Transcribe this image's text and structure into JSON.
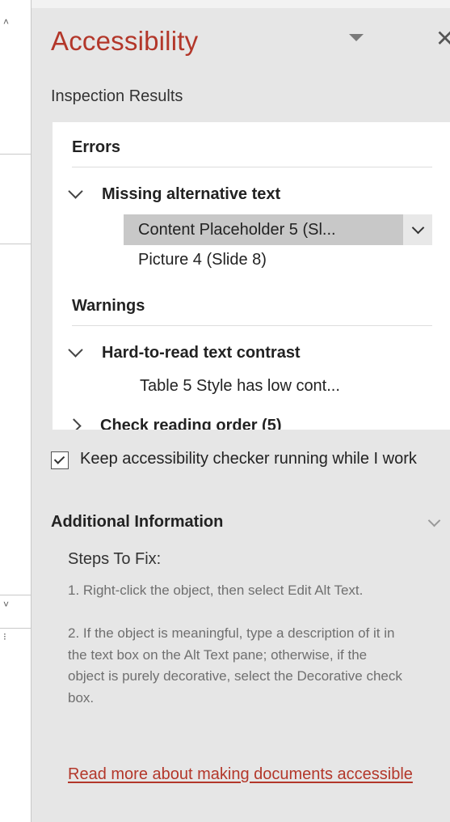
{
  "pane": {
    "title": "Accessibility",
    "section_label": "Inspection Results"
  },
  "results": {
    "errors_label": "Errors",
    "errors": [
      {
        "name": "Missing alternative text",
        "items": [
          "Content Placeholder 5  (Sl...",
          "Picture 4  (Slide 8)"
        ]
      }
    ],
    "warnings_label": "Warnings",
    "warnings": [
      {
        "name": "Hard-to-read text contrast",
        "items": [
          "Table 5 Style has low cont..."
        ]
      },
      {
        "name": "Check reading order (5)",
        "items": []
      }
    ]
  },
  "keep_running": {
    "checked": true,
    "label": "Keep accessibility checker running while I work"
  },
  "additional_info": {
    "title": "Additional Information",
    "steps_title": "Steps To Fix:",
    "step1": "1. Right-click the object, then select Edit Alt Text.",
    "step2": "2. If the object is meaningful, type a description of it in the text box on the Alt Text pane; otherwise, if the object is purely decorative, select the Decorative check box.",
    "read_more": "Read more about making documents accessible"
  },
  "colors": {
    "accent": "#b3372a",
    "pane_bg": "#e6e6e6",
    "selected_bg": "#c8c8c8"
  }
}
